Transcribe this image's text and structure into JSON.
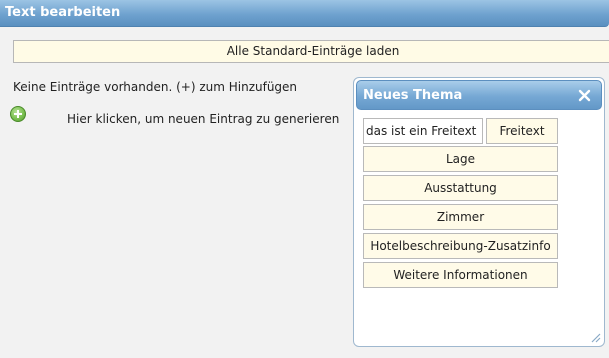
{
  "window": {
    "title": "Text bearbeiten"
  },
  "toolbar": {
    "load_defaults_label": "Alle Standard-Einträge laden"
  },
  "list": {
    "empty_message": "Keine Einträge vorhanden. (+) zum Hinzufügen",
    "add_entry_label": "Hier klicken, um neuen Eintrag zu generieren",
    "add_icon": "plus-circle-icon"
  },
  "panel": {
    "title": "Neues Thema",
    "close_icon": "close-icon",
    "freetext_input_value": "das ist ein Freitext",
    "freetext_button_label": "Freitext",
    "options": [
      {
        "label": "Lage"
      },
      {
        "label": "Ausstattung"
      },
      {
        "label": "Zimmer"
      },
      {
        "label": "Hotelbeschreibung-Zusatzinfo"
      },
      {
        "label": "Weitere Informationen"
      }
    ]
  },
  "colors": {
    "title_bar": "#6fa2cf",
    "button_background": "#fffbe8",
    "add_icon_green": "#7cc152"
  }
}
